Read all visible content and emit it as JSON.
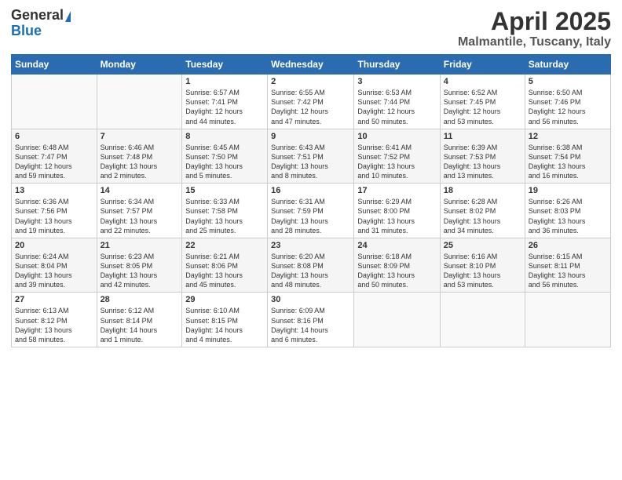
{
  "header": {
    "logo_general": "General",
    "logo_blue": "Blue",
    "title": "April 2025",
    "location": "Malmantile, Tuscany, Italy"
  },
  "weekdays": [
    "Sunday",
    "Monday",
    "Tuesday",
    "Wednesday",
    "Thursday",
    "Friday",
    "Saturday"
  ],
  "weeks": [
    [
      {
        "day": "",
        "info": ""
      },
      {
        "day": "",
        "info": ""
      },
      {
        "day": "1",
        "info": "Sunrise: 6:57 AM\nSunset: 7:41 PM\nDaylight: 12 hours\nand 44 minutes."
      },
      {
        "day": "2",
        "info": "Sunrise: 6:55 AM\nSunset: 7:42 PM\nDaylight: 12 hours\nand 47 minutes."
      },
      {
        "day": "3",
        "info": "Sunrise: 6:53 AM\nSunset: 7:44 PM\nDaylight: 12 hours\nand 50 minutes."
      },
      {
        "day": "4",
        "info": "Sunrise: 6:52 AM\nSunset: 7:45 PM\nDaylight: 12 hours\nand 53 minutes."
      },
      {
        "day": "5",
        "info": "Sunrise: 6:50 AM\nSunset: 7:46 PM\nDaylight: 12 hours\nand 56 minutes."
      }
    ],
    [
      {
        "day": "6",
        "info": "Sunrise: 6:48 AM\nSunset: 7:47 PM\nDaylight: 12 hours\nand 59 minutes."
      },
      {
        "day": "7",
        "info": "Sunrise: 6:46 AM\nSunset: 7:48 PM\nDaylight: 13 hours\nand 2 minutes."
      },
      {
        "day": "8",
        "info": "Sunrise: 6:45 AM\nSunset: 7:50 PM\nDaylight: 13 hours\nand 5 minutes."
      },
      {
        "day": "9",
        "info": "Sunrise: 6:43 AM\nSunset: 7:51 PM\nDaylight: 13 hours\nand 8 minutes."
      },
      {
        "day": "10",
        "info": "Sunrise: 6:41 AM\nSunset: 7:52 PM\nDaylight: 13 hours\nand 10 minutes."
      },
      {
        "day": "11",
        "info": "Sunrise: 6:39 AM\nSunset: 7:53 PM\nDaylight: 13 hours\nand 13 minutes."
      },
      {
        "day": "12",
        "info": "Sunrise: 6:38 AM\nSunset: 7:54 PM\nDaylight: 13 hours\nand 16 minutes."
      }
    ],
    [
      {
        "day": "13",
        "info": "Sunrise: 6:36 AM\nSunset: 7:56 PM\nDaylight: 13 hours\nand 19 minutes."
      },
      {
        "day": "14",
        "info": "Sunrise: 6:34 AM\nSunset: 7:57 PM\nDaylight: 13 hours\nand 22 minutes."
      },
      {
        "day": "15",
        "info": "Sunrise: 6:33 AM\nSunset: 7:58 PM\nDaylight: 13 hours\nand 25 minutes."
      },
      {
        "day": "16",
        "info": "Sunrise: 6:31 AM\nSunset: 7:59 PM\nDaylight: 13 hours\nand 28 minutes."
      },
      {
        "day": "17",
        "info": "Sunrise: 6:29 AM\nSunset: 8:00 PM\nDaylight: 13 hours\nand 31 minutes."
      },
      {
        "day": "18",
        "info": "Sunrise: 6:28 AM\nSunset: 8:02 PM\nDaylight: 13 hours\nand 34 minutes."
      },
      {
        "day": "19",
        "info": "Sunrise: 6:26 AM\nSunset: 8:03 PM\nDaylight: 13 hours\nand 36 minutes."
      }
    ],
    [
      {
        "day": "20",
        "info": "Sunrise: 6:24 AM\nSunset: 8:04 PM\nDaylight: 13 hours\nand 39 minutes."
      },
      {
        "day": "21",
        "info": "Sunrise: 6:23 AM\nSunset: 8:05 PM\nDaylight: 13 hours\nand 42 minutes."
      },
      {
        "day": "22",
        "info": "Sunrise: 6:21 AM\nSunset: 8:06 PM\nDaylight: 13 hours\nand 45 minutes."
      },
      {
        "day": "23",
        "info": "Sunrise: 6:20 AM\nSunset: 8:08 PM\nDaylight: 13 hours\nand 48 minutes."
      },
      {
        "day": "24",
        "info": "Sunrise: 6:18 AM\nSunset: 8:09 PM\nDaylight: 13 hours\nand 50 minutes."
      },
      {
        "day": "25",
        "info": "Sunrise: 6:16 AM\nSunset: 8:10 PM\nDaylight: 13 hours\nand 53 minutes."
      },
      {
        "day": "26",
        "info": "Sunrise: 6:15 AM\nSunset: 8:11 PM\nDaylight: 13 hours\nand 56 minutes."
      }
    ],
    [
      {
        "day": "27",
        "info": "Sunrise: 6:13 AM\nSunset: 8:12 PM\nDaylight: 13 hours\nand 58 minutes."
      },
      {
        "day": "28",
        "info": "Sunrise: 6:12 AM\nSunset: 8:14 PM\nDaylight: 14 hours\nand 1 minute."
      },
      {
        "day": "29",
        "info": "Sunrise: 6:10 AM\nSunset: 8:15 PM\nDaylight: 14 hours\nand 4 minutes."
      },
      {
        "day": "30",
        "info": "Sunrise: 6:09 AM\nSunset: 8:16 PM\nDaylight: 14 hours\nand 6 minutes."
      },
      {
        "day": "",
        "info": ""
      },
      {
        "day": "",
        "info": ""
      },
      {
        "day": "",
        "info": ""
      }
    ]
  ]
}
